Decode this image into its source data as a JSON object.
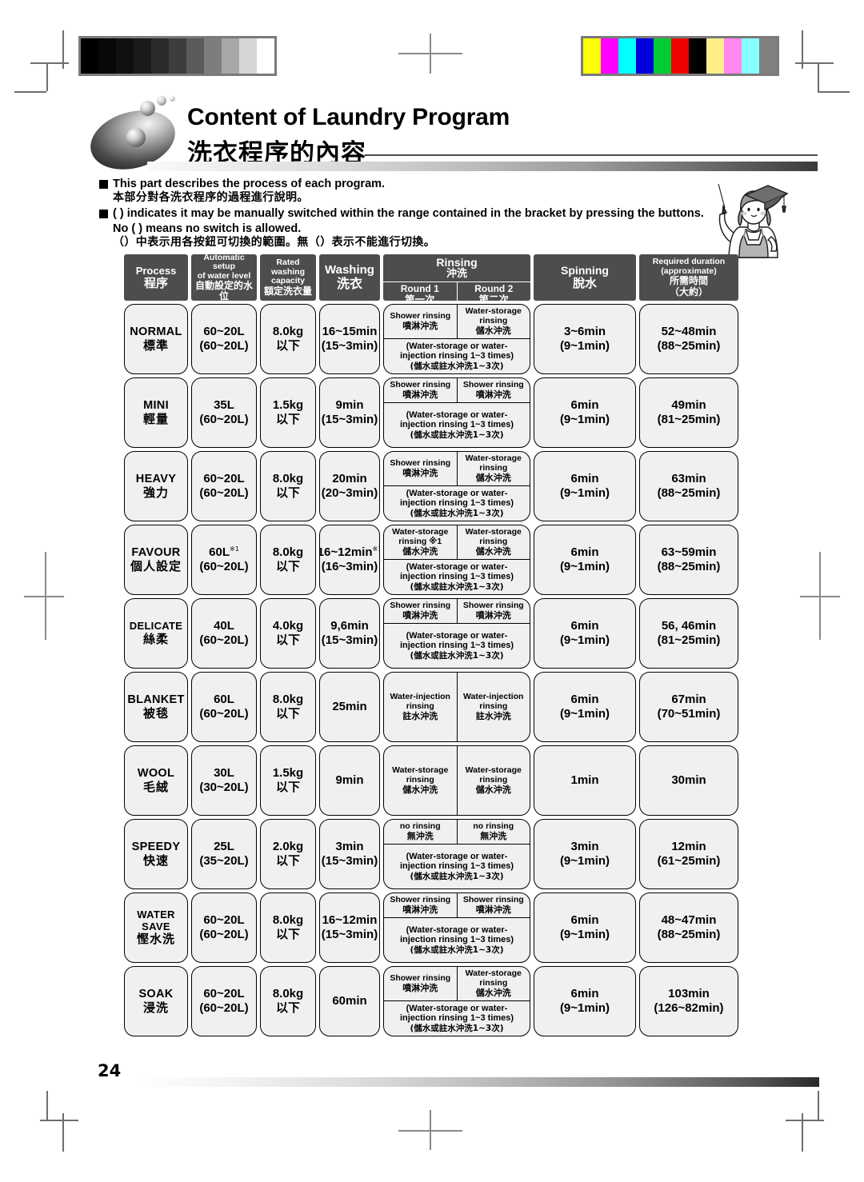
{
  "title": {
    "en": "Content of Laundry Program",
    "cn": "洗衣程序的內容"
  },
  "bullets": [
    {
      "en": "This part describes the process of each program.",
      "cn": "本部分對各洗衣程序的過程進行說明。"
    },
    {
      "en": "( ) indicates it may be manually switched within the range contained in the bracket by pressing the buttons. No ( ) means no switch is allowed.",
      "cn": "（）中表示用各按鈕可切換的範圍。無（）表示不能進行切換。"
    }
  ],
  "table": {
    "headers": {
      "process": {
        "en": "Process",
        "cn": "程序"
      },
      "water_level": {
        "en": "Automatic setup of water level",
        "cn": "自動設定的水位"
      },
      "capacity": {
        "en": "Rated washing capacity",
        "cn": "額定洗衣量"
      },
      "washing": {
        "en": "Washing",
        "cn": "洗衣"
      },
      "rinsing": {
        "en": "Rinsing",
        "cn": "沖洗"
      },
      "round1": {
        "en": "Round 1",
        "cn": "第一次"
      },
      "round2": {
        "en": "Round 2",
        "cn": "第二次"
      },
      "spinning": {
        "en": "Spinning",
        "cn": "脫水"
      },
      "duration": {
        "en": "Required duration (approximate)",
        "cn": "所需時間（大約）"
      }
    },
    "rows": [
      {
        "process": {
          "en": "NORMAL",
          "cn": "標準"
        },
        "water_level": {
          "l1": "60~20L",
          "l2": "(60~20L)"
        },
        "capacity": {
          "l1": "8.0kg",
          "l2": "以下"
        },
        "washing": {
          "l1": "16~15min",
          "l2": "(15~3min)"
        },
        "round1": {
          "en": "Shower rinsing",
          "cn": "噴淋沖洗"
        },
        "round2": {
          "en": "Water-storage rinsing",
          "cn": "儲水沖洗"
        },
        "note": {
          "en": "(Water-storage or water-injection rinsing 1~3 times)",
          "cn": "(儲水或註水沖洗1~3次)"
        },
        "spinning": {
          "l1": "3~6min",
          "l2": "(9~1min)"
        },
        "duration": {
          "l1": "52~48min",
          "l2": "(88~25min)"
        }
      },
      {
        "process": {
          "en": "MINI",
          "cn": "輕量"
        },
        "water_level": {
          "l1": "35L",
          "l2": "(60~20L)"
        },
        "capacity": {
          "l1": "1.5kg",
          "l2": "以下"
        },
        "washing": {
          "l1": "9min",
          "l2": "(15~3min)"
        },
        "round1": {
          "en": "Shower rinsing",
          "cn": "噴淋沖洗"
        },
        "round2": {
          "en": "Shower rinsing",
          "cn": "噴淋沖洗"
        },
        "note": {
          "en": "(Water-storage or water-injection rinsing 1~3 times)",
          "cn": "(儲水或註水沖洗1~3次)"
        },
        "spinning": {
          "l1": "6min",
          "l2": "(9~1min)"
        },
        "duration": {
          "l1": "49min",
          "l2": "(81~25min)"
        }
      },
      {
        "process": {
          "en": "HEAVY",
          "cn": "強力"
        },
        "water_level": {
          "l1": "60~20L",
          "l2": "(60~20L)"
        },
        "capacity": {
          "l1": "8.0kg",
          "l2": "以下"
        },
        "washing": {
          "l1": "20min",
          "l2": "(20~3min)"
        },
        "round1": {
          "en": "Shower rinsing",
          "cn": "噴淋沖洗"
        },
        "round2": {
          "en": "Water-storage rinsing",
          "cn": "儲水沖洗"
        },
        "note": {
          "en": "(Water-storage or water-injection rinsing 1~3 times)",
          "cn": "(儲水或註水沖洗1~3次)"
        },
        "spinning": {
          "l1": "6min",
          "l2": "(9~1min)"
        },
        "duration": {
          "l1": "63min",
          "l2": "(88~25min)"
        }
      },
      {
        "process": {
          "en": "FAVOUR",
          "cn": "個人設定"
        },
        "water_level": {
          "l1": "60L",
          "l1_sup": "※1",
          "l2": "(60~20L)"
        },
        "capacity": {
          "l1": "8.0kg",
          "l2": "以下"
        },
        "washing": {
          "l1": "16~12min",
          "l1_sup": "※1",
          "l2": "(16~3min)"
        },
        "round1": {
          "en": "Water-storage rinsing ※1",
          "cn": "儲水沖洗"
        },
        "round2": {
          "en": "Water-storage rinsing",
          "cn": "儲水沖洗"
        },
        "note": {
          "en": "(Water-storage or water-injection rinsing 1~3 times)",
          "cn": "(儲水或註水沖洗1~3次)"
        },
        "spinning": {
          "l1": "6min",
          "l2": "(9~1min)"
        },
        "duration": {
          "l1": "63~59min",
          "l2": "(88~25min)"
        }
      },
      {
        "process": {
          "en": "DELICATE",
          "cn": "絲柔"
        },
        "water_level": {
          "l1": "40L",
          "l2": "(60~20L)"
        },
        "capacity": {
          "l1": "4.0kg",
          "l2": "以下"
        },
        "washing": {
          "l1": "9,6min",
          "l2": "(15~3min)"
        },
        "round1": {
          "en": "Shower rinsing",
          "cn": "噴淋沖洗"
        },
        "round2": {
          "en": "Shower rinsing",
          "cn": "噴淋沖洗"
        },
        "note": {
          "en": "(Water-storage or water-injection rinsing 1~3 times)",
          "cn": "(儲水或註水沖洗1~3次)"
        },
        "spinning": {
          "l1": "6min",
          "l2": "(9~1min)"
        },
        "duration": {
          "l1": "56, 46min",
          "l2": "(81~25min)"
        }
      },
      {
        "process": {
          "en": "BLANKET",
          "cn": "被毯"
        },
        "water_level": {
          "l1": "60L",
          "l2": "(60~20L)"
        },
        "capacity": {
          "l1": "8.0kg",
          "l2": "以下"
        },
        "washing": {
          "l1": "25min",
          "l2": ""
        },
        "round1": {
          "en": "Water-injection rinsing",
          "cn": "註水沖洗"
        },
        "round2": {
          "en": "Water-injection rinsing",
          "cn": "註水沖洗"
        },
        "note": null,
        "spinning": {
          "l1": "6min",
          "l2": "(9~1min)"
        },
        "duration": {
          "l1": "67min",
          "l2": "(70~51min)"
        }
      },
      {
        "process": {
          "en": "WOOL",
          "cn": "毛絨"
        },
        "water_level": {
          "l1": "30L",
          "l2": "(30~20L)"
        },
        "capacity": {
          "l1": "1.5kg",
          "l2": "以下"
        },
        "washing": {
          "l1": "9min",
          "l2": ""
        },
        "round1": {
          "en": "Water-storage rinsing",
          "cn": "儲水沖洗"
        },
        "round2": {
          "en": "Water-storage rinsing",
          "cn": "儲水沖洗"
        },
        "note": null,
        "spinning": {
          "l1": "1min",
          "l2": ""
        },
        "duration": {
          "l1": "30min",
          "l2": ""
        }
      },
      {
        "process": {
          "en": "SPEEDY",
          "cn": "快速"
        },
        "water_level": {
          "l1": "25L",
          "l2": "(35~20L)"
        },
        "capacity": {
          "l1": "2.0kg",
          "l2": "以下"
        },
        "washing": {
          "l1": "3min",
          "l2": "(15~3min)"
        },
        "round1": {
          "en": "no rinsing",
          "cn": "無沖洗"
        },
        "round2": {
          "en": "no rinsing",
          "cn": "無沖洗"
        },
        "note": {
          "en": "(Water-storage or water-injection rinsing 1~3 times)",
          "cn": "(儲水或註水沖洗1~3次)"
        },
        "spinning": {
          "l1": "3min",
          "l2": "(9~1min)"
        },
        "duration": {
          "l1": "12min",
          "l2": "(61~25min)"
        }
      },
      {
        "process": {
          "en": "WATER SAVE",
          "cn": "慳水洗"
        },
        "water_level": {
          "l1": "60~20L",
          "l2": "(60~20L)"
        },
        "capacity": {
          "l1": "8.0kg",
          "l2": "以下"
        },
        "washing": {
          "l1": "16~12min",
          "l2": "(15~3min)"
        },
        "round1": {
          "en": "Shower rinsing",
          "cn": "噴淋沖洗"
        },
        "round2": {
          "en": "Shower rinsing",
          "cn": "噴淋沖洗"
        },
        "note": {
          "en": "(Water-storage or water-injection rinsing 1~3 times)",
          "cn": "(儲水或註水沖洗1~3次)"
        },
        "spinning": {
          "l1": "6min",
          "l2": "(9~1min)"
        },
        "duration": {
          "l1": "48~47min",
          "l2": "(88~25min)"
        }
      },
      {
        "process": {
          "en": "SOAK",
          "cn": "浸洗"
        },
        "water_level": {
          "l1": "60~20L",
          "l2": "(60~20L)"
        },
        "capacity": {
          "l1": "8.0kg",
          "l2": "以下"
        },
        "washing": {
          "l1": "60min",
          "l2": ""
        },
        "round1": {
          "en": "Shower rinsing",
          "cn": "噴淋沖洗"
        },
        "round2": {
          "en": "Water-storage rinsing",
          "cn": "儲水沖洗"
        },
        "note": {
          "en": "(Water-storage or water-injection rinsing 1~3 times)",
          "cn": "(儲水或註水沖洗1~3次)"
        },
        "spinning": {
          "l1": "6min",
          "l2": "(9~1min)"
        },
        "duration": {
          "l1": "103min",
          "l2": "(126~82min)"
        }
      }
    ]
  },
  "footer": {
    "page_number": "24"
  },
  "print_marks": {
    "grayscale_bar": [
      "#000000",
      "#080808",
      "#101010",
      "#1a1a1a",
      "#2b2b2b",
      "#3d3d3d",
      "#5a5a5a",
      "#7d7d7d",
      "#a8a8a8",
      "#d6d6d6",
      "#ffffff"
    ],
    "color_bar": [
      "#ffff00",
      "#ff00ff",
      "#00ffff",
      "#0000dd",
      "#00cc33",
      "#ee0000",
      "#000000",
      "#ffee88",
      "#ff88ee",
      "#88ffff",
      "#808080"
    ]
  }
}
